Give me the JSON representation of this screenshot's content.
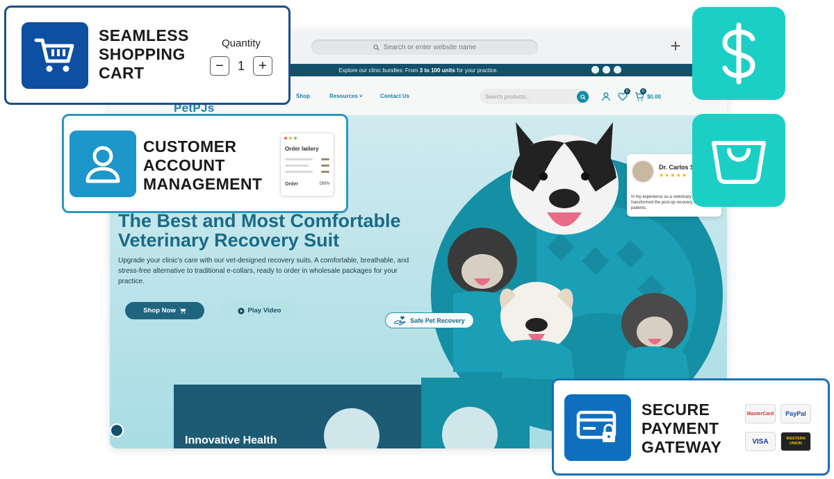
{
  "browser": {
    "address_placeholder": "Search or enter website name",
    "new_tab_symbol": "+"
  },
  "site": {
    "topbar": {
      "text_pre": "Explore our clinic bundles: From ",
      "text_bold": "3 to 100 units",
      "text_post": " for your practice."
    },
    "nav": {
      "logo": "PetPJs",
      "links": [
        "Shop",
        "Resources ˅",
        "Contact Us"
      ],
      "search_placeholder": "Search products...",
      "wishlist_count": "0",
      "cart_count": "0",
      "cart_total": "$0.00"
    },
    "hero": {
      "title": "The Best and Most Comfortable Veterinary Recovery Suit",
      "description": "Upgrade your clinic's care with our vet-designed recovery suits. A comfortable, breathable, and stress-free alternative to traditional e-collars, ready to order in wholesale packages for your practice.",
      "shop_now_label": "Shop Now",
      "play_video_label": "Play Video",
      "safe_pet_label": "Safe Pet Recovery"
    },
    "review": {
      "name": "Dr. Carlos S",
      "stars": "★★★★★",
      "text": "In my experience as a veterinary Pet PJs has transformed the post-op recovery of my patients."
    },
    "bottom": {
      "card_heading": "Innovative Health"
    }
  },
  "features": {
    "cart": {
      "title_line1": "SEAMLESS",
      "title_line2": "SHOPPING",
      "title_line3": "CART",
      "quantity_label": "Quantity",
      "quantity_value": "1",
      "minus": "−",
      "plus": "+"
    },
    "account": {
      "title_line1": "CUSTOMER",
      "title_line2": "ACCOUNT",
      "title_line3": "MANAGEMENT",
      "order_header": "Order Iмilery",
      "order_footer": "Order",
      "order_footer_right": "DBIN"
    },
    "payment": {
      "title_line1": "SECURE",
      "title_line2": "PAYMENT",
      "title_line3": "GATEWAY",
      "logos": [
        "MasterCard",
        "PayPal",
        "VISA",
        "WESTERN UNION"
      ]
    }
  },
  "colors": {
    "teal_tile": "#1ccfc5",
    "cart_blue": "#0d4fa0",
    "account_blue": "#1d96c9",
    "payment_blue": "#0e6fbf",
    "site_dark": "#13506a",
    "site_teal": "#148fa3"
  },
  "icons": {
    "cart": "shopping-cart-icon",
    "account": "user-icon",
    "payment": "credit-card-lock-icon",
    "dollar": "dollar-icon",
    "bag": "shopping-bag-icon"
  }
}
